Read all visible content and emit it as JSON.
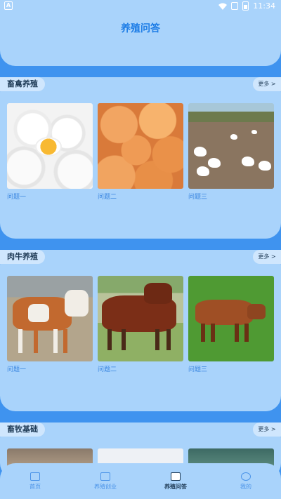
{
  "status_bar": {
    "time": "11:34",
    "left_icon": "A"
  },
  "header": {
    "title": "养殖问答"
  },
  "sections": [
    {
      "title": "畜禽养殖",
      "more": "更多 >",
      "items": [
        {
          "caption": "问题一",
          "image": "white-eggs-image"
        },
        {
          "caption": "问题二",
          "image": "brown-eggs-image"
        },
        {
          "caption": "问题三",
          "image": "chickens-image"
        }
      ]
    },
    {
      "title": "肉牛养殖",
      "more": "更多 >",
      "items": [
        {
          "caption": "问题一",
          "image": "cattle-image"
        },
        {
          "caption": "问题二",
          "image": "brown-bull-image"
        },
        {
          "caption": "问题三",
          "image": "red-bull-image"
        }
      ]
    },
    {
      "title": "畜牧基础",
      "more": "更多 >",
      "items": []
    }
  ],
  "bottom_nav": [
    {
      "label": "首页",
      "icon": "home-icon",
      "active": false
    },
    {
      "label": "养殖创业",
      "icon": "farm-icon",
      "active": false
    },
    {
      "label": "养殖问答",
      "icon": "qa-book-icon",
      "active": true
    },
    {
      "label": "我的",
      "icon": "user-icon",
      "active": false
    }
  ],
  "colors": {
    "page_bg": "#3f93ef",
    "panel_bg": "#a9d3fb",
    "accent": "#1e7de6"
  }
}
